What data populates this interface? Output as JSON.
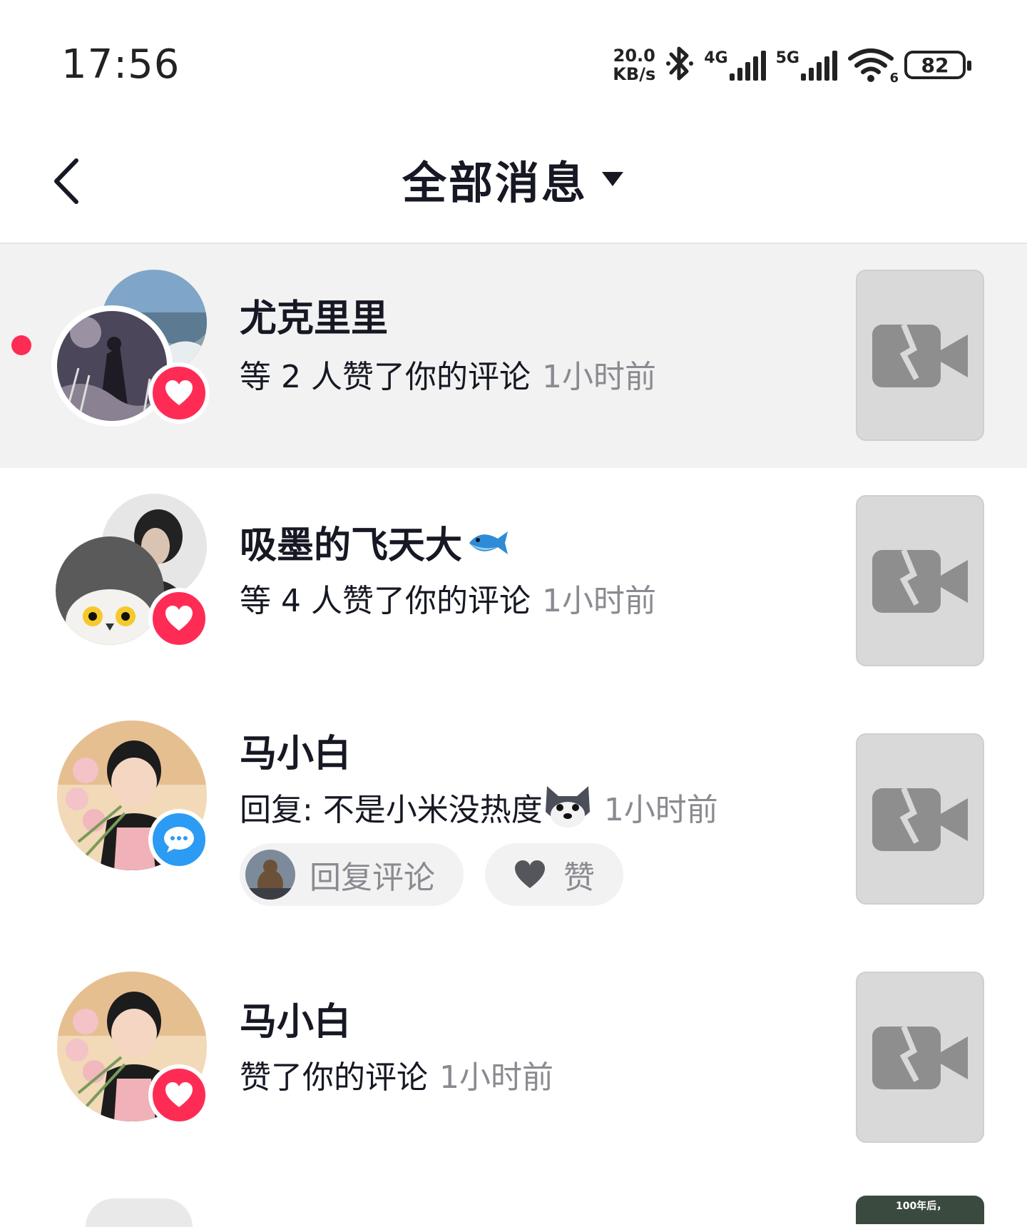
{
  "status_bar": {
    "time": "17:56",
    "net_speed_value": "20.0",
    "net_speed_unit": "KB/s",
    "signal1_label": "4G",
    "signal2_label": "5G",
    "wifi_label": "6",
    "battery": "82"
  },
  "header": {
    "title": "全部消息",
    "back_icon": "chevron-left-icon",
    "dropdown_icon": "caret-down-icon"
  },
  "messages": [
    {
      "name": "尤克里里",
      "prefix": "等 2 人赞了你的评论",
      "time": "1小时前",
      "type": "like",
      "unread": true
    },
    {
      "name": "吸墨的飞天大",
      "name_emoji": "fish-icon",
      "prefix": "等 4 人赞了你的评论",
      "time": "1小时前",
      "type": "like",
      "unread": false
    },
    {
      "name": "马小白",
      "prefix": "回复: 不是小米没热度",
      "prefix_emoji": "dog-face-icon",
      "time": "1小时前",
      "type": "comment",
      "reply_label": "回复评论",
      "like_label": "赞"
    },
    {
      "name": "马小白",
      "prefix": "赞了你的评论",
      "time": "1小时前",
      "type": "like"
    }
  ],
  "peek": {
    "thumb_text": "100年后，"
  },
  "colors": {
    "accent_red": "#fe2c55",
    "comment_blue": "#2b9bf4",
    "muted_text": "#8a8b91",
    "highlight_bg": "#f2f2f2"
  }
}
